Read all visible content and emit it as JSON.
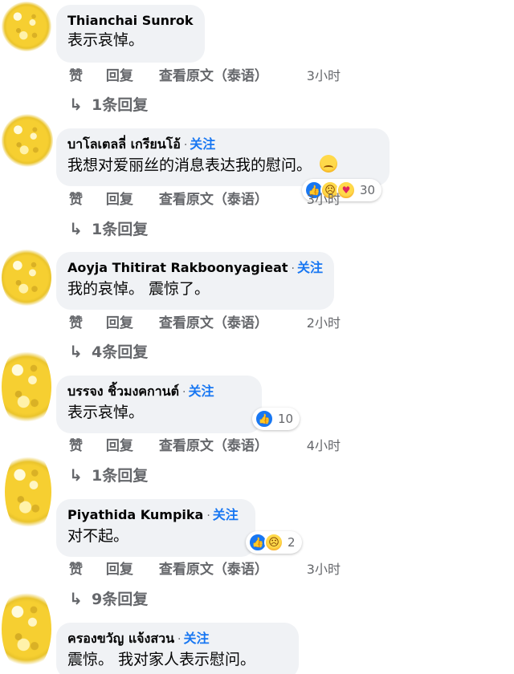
{
  "action_labels": {
    "like": "赞",
    "reply": "回复",
    "see_original": "查看原文（泰语）"
  },
  "reply_arrow": "↳",
  "comments": [
    {
      "author": "Thianchai Sunrok",
      "follow": "",
      "text": "表示哀悼。",
      "time": "3小时",
      "replies": "1条回复"
    },
    {
      "author": "บาโลเตลลี่ เกรียนโอ้",
      "separator": "·",
      "follow": "关注",
      "text": "我想对爱丽丝的消息表达我的慰问。",
      "emoji": "crying-face",
      "reactions": [
        "like",
        "sad",
        "care"
      ],
      "reaction_count": "30",
      "time": "3小时",
      "replies": "1条回复"
    },
    {
      "author": "Aoyja Thitirat Rakboonyagieat",
      "separator": "·",
      "follow": "关注",
      "text": "我的哀悼。 震惊了。",
      "time": "2小时",
      "replies": "4条回复"
    },
    {
      "author": "บรรจง ชิ้วมงคกานต์",
      "separator": "·",
      "follow": "关注",
      "text": "表示哀悼。",
      "reactions": [
        "like"
      ],
      "reaction_count": "10",
      "time": "4小时",
      "replies": "1条回复"
    },
    {
      "author": "Piyathida Kumpika",
      "separator": "·",
      "follow": "关注",
      "text": "对不起。",
      "reactions": [
        "like",
        "sad"
      ],
      "reaction_count": "2",
      "time": "3小时",
      "replies": "9条回复"
    },
    {
      "author": "ครองขวัญ แจ้งสวน",
      "separator": "·",
      "follow": "关注",
      "text": "震惊。 我对家人表示慰问。"
    }
  ]
}
